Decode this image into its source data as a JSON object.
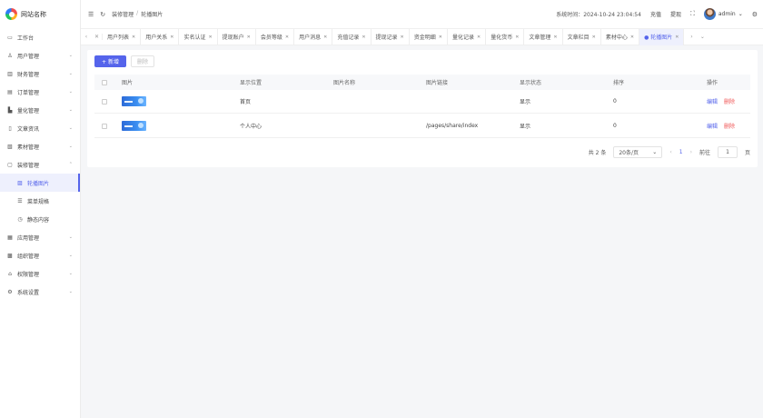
{
  "app": {
    "title": "网站名称"
  },
  "sidebar": {
    "items": [
      {
        "label": "工作台",
        "icon": "desktop-icon",
        "glyph": "▭",
        "chev": ""
      },
      {
        "label": "用户管理",
        "icon": "user-icon",
        "glyph": "♙",
        "chev": "⌄"
      },
      {
        "label": "财务管理",
        "icon": "finance-icon",
        "glyph": "▥",
        "chev": "⌄"
      },
      {
        "label": "订单管理",
        "icon": "order-icon",
        "glyph": "▤",
        "chev": "⌄"
      },
      {
        "label": "量化管理",
        "icon": "quant-icon",
        "glyph": "▙",
        "chev": "⌄"
      },
      {
        "label": "文章资讯",
        "icon": "article-icon",
        "glyph": "▯",
        "chev": "⌄"
      },
      {
        "label": "素材管理",
        "icon": "material-icon",
        "glyph": "▧",
        "chev": "⌄"
      },
      {
        "label": "装修管理",
        "icon": "decorate-icon",
        "glyph": "▢",
        "chev": "⌃"
      },
      {
        "label": "轮播图片",
        "icon": "image-icon",
        "glyph": "▨",
        "chev": "",
        "sub": true,
        "active": true
      },
      {
        "label": "菜单规格",
        "icon": "list-icon",
        "glyph": "☰",
        "chev": "",
        "sub": true
      },
      {
        "label": "静态内容",
        "icon": "clock-icon",
        "glyph": "◷",
        "chev": "",
        "sub": true
      },
      {
        "label": "应用管理",
        "icon": "app-icon",
        "glyph": "▦",
        "chev": "⌄"
      },
      {
        "label": "组织管理",
        "icon": "org-icon",
        "glyph": "▩",
        "chev": "⌄"
      },
      {
        "label": "权限管理",
        "icon": "lock-icon",
        "glyph": "⌂",
        "chev": "⌄"
      },
      {
        "label": "系统设置",
        "icon": "gear-icon",
        "glyph": "⚙",
        "chev": "⌄"
      }
    ]
  },
  "header": {
    "breadcrumb": [
      "装修管理",
      "轮播图片"
    ],
    "breadcrumb_sep": "/",
    "systime": "系统时间：2024-10-24 23:04:54",
    "recharge": "充值",
    "withdraw": "提现",
    "user": "admin",
    "user_chev": "⌄"
  },
  "tabs": {
    "items": [
      {
        "label": "用户列表"
      },
      {
        "label": "用户关系"
      },
      {
        "label": "实名认证"
      },
      {
        "label": "提现账户"
      },
      {
        "label": "会员等级"
      },
      {
        "label": "用户消息"
      },
      {
        "label": "充值记录"
      },
      {
        "label": "提现记录"
      },
      {
        "label": "资金明细"
      },
      {
        "label": "量化记录"
      },
      {
        "label": "量化货币"
      },
      {
        "label": "文章管理"
      },
      {
        "label": "文章栏目"
      },
      {
        "label": "素材中心"
      },
      {
        "label": "● 轮播图片",
        "active": true
      }
    ],
    "close_glyph": "✕"
  },
  "toolbar": {
    "add_label": "+ 新增",
    "delete_label": "删除"
  },
  "table": {
    "columns": [
      "图片",
      "显示位置",
      "图片名称",
      "图片链接",
      "显示状态",
      "排序",
      "操作"
    ],
    "rows": [
      {
        "position": "首页",
        "name": "",
        "link": "",
        "status": "显示",
        "sort": "0",
        "edit": "编辑",
        "delete": "删除"
      },
      {
        "position": "个人中心",
        "name": "",
        "link": "/pages/share/index",
        "status": "显示",
        "sort": "0",
        "edit": "编辑",
        "delete": "删除"
      }
    ]
  },
  "pagination": {
    "total": "共 2 条",
    "page_size": "20条/页",
    "prev": "‹",
    "current": "1",
    "next": "›",
    "goto_label": "前往",
    "goto_value": "1",
    "page_unit": "页"
  },
  "colors": {
    "primary": "#5564eb",
    "danger": "#f05656"
  }
}
